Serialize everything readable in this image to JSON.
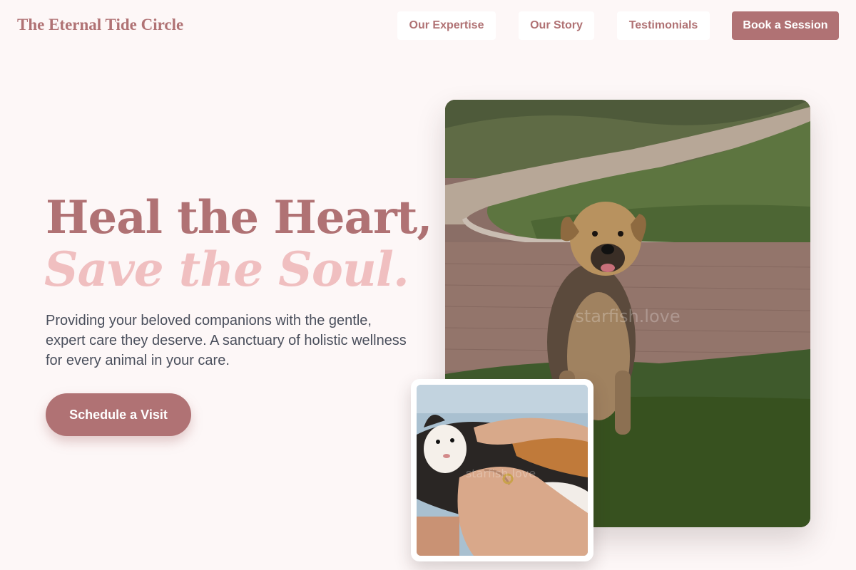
{
  "brand": {
    "name": "The Eternal Tide Circle"
  },
  "nav": {
    "links": [
      "Our Expertise",
      "Our Story",
      "Testimonials"
    ],
    "cta": "Book a Session"
  },
  "hero": {
    "title_line1": "Heal the Heart,",
    "title_line2": "Save the Soul.",
    "subtitle": "Providing your beloved companions with the gentle, expert care they deserve. A sanctuary of holistic wellness for every animal in your care.",
    "cta": "Schedule a Visit"
  },
  "images": {
    "main": {
      "icon": "dog-photo",
      "watermark": "starfish.love"
    },
    "inset": {
      "icon": "cat-photo",
      "watermark": "starfish.love"
    }
  },
  "colors": {
    "accent": "#b07274",
    "accent_light": "#f0bfc0",
    "background": "#fdf7f7",
    "body_text": "#4a4f5c"
  }
}
